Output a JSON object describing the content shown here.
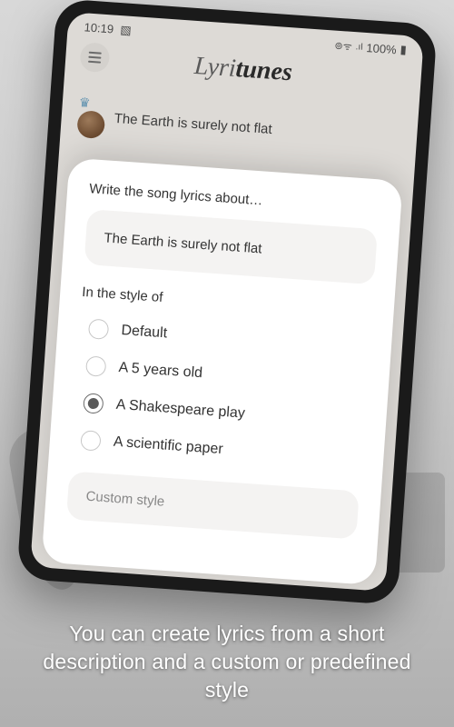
{
  "statusbar": {
    "time": "10:19",
    "battery": "100%"
  },
  "app": {
    "logo_part1": "Lyri",
    "logo_part2": "tunes"
  },
  "prev_item": {
    "title": "The Earth is surely not flat"
  },
  "modal": {
    "prompt_label": "Write the song lyrics about…",
    "prompt_value": "The Earth is surely not flat",
    "style_label": "In the style of",
    "options": [
      {
        "label": "Default",
        "selected": false
      },
      {
        "label": "A 5 years old",
        "selected": false
      },
      {
        "label": "A Shakespeare play",
        "selected": true
      },
      {
        "label": "A scientific paper",
        "selected": false
      }
    ],
    "custom_placeholder": "Custom style"
  },
  "caption": "You can create lyrics from a short description and a custom or predefined style"
}
